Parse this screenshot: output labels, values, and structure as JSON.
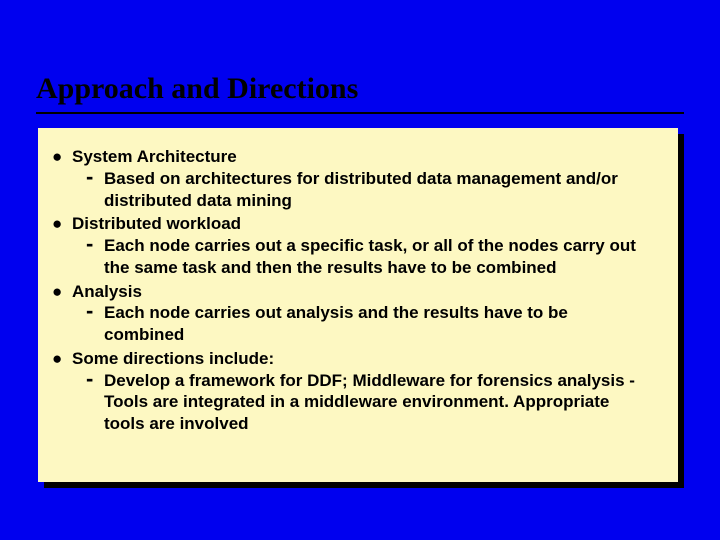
{
  "slide": {
    "title": "Approach and Directions",
    "items": [
      {
        "label": "System Architecture",
        "sub": "Based on architectures for distributed data management and/or distributed data mining"
      },
      {
        "label": "Distributed workload",
        "sub": "Each node carries out a specific task, or all of the nodes carry out the same task and then the results have to be combined"
      },
      {
        "label": "Analysis",
        "sub": "Each node carries out analysis and the results have to be combined"
      },
      {
        "label": "Some directions include:",
        "sub": "Develop a framework for DDF; Middleware for forensics analysis - Tools are integrated in a middleware environment. Appropriate tools are involved"
      }
    ]
  }
}
